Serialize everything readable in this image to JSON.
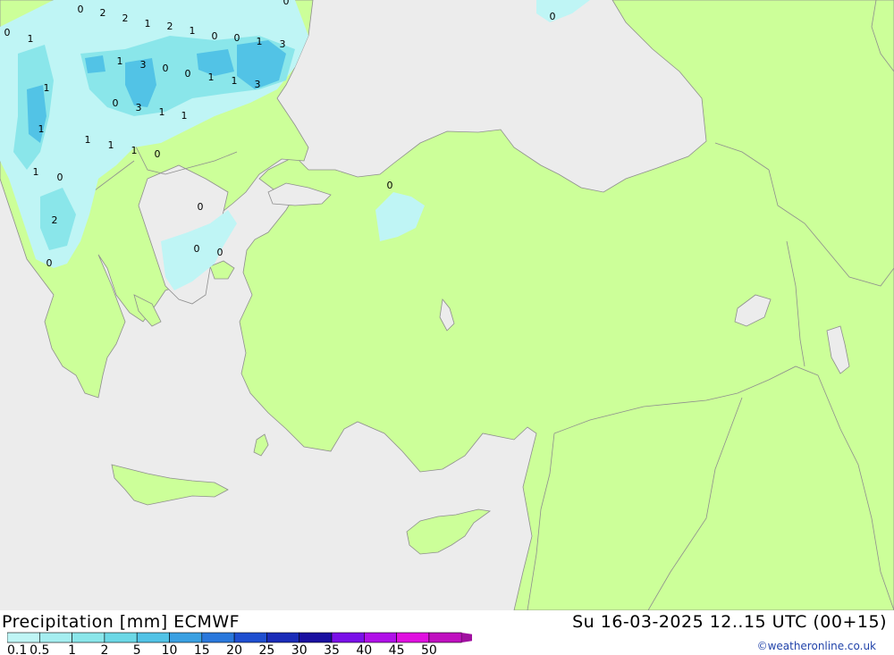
{
  "header": {
    "title": "Precipitation [mm] ECMWF",
    "datetime": "Su 16-03-2025 12..15 UTC (00+15)",
    "credit": "©weatheronline.co.uk"
  },
  "legend": {
    "ticks": [
      "0.1",
      "0.5",
      "1",
      "2",
      "5",
      "10",
      "15",
      "20",
      "25",
      "30",
      "35",
      "40",
      "45",
      "50"
    ],
    "colors": [
      "#bff5f5",
      "#a5eef0",
      "#8ae6ea",
      "#6cd8e6",
      "#52c3e6",
      "#3aa0e2",
      "#2a78dc",
      "#1f4fd0",
      "#1a2cb8",
      "#1a10a0",
      "#7a10e8",
      "#b010e8",
      "#e010e0",
      "#c010c0",
      "#a010a0"
    ]
  },
  "map": {
    "colors": {
      "land": "#ccff99",
      "sea": "#ececec",
      "border": "#8e8e8e",
      "precip_light": "#bff5f5",
      "precip_mid": "#8ae6ea",
      "precip_heavy": "#52c3e6"
    },
    "labels": [
      "0",
      "2",
      "2",
      "1",
      "2",
      "1",
      "0",
      "0",
      "1",
      "3",
      "0",
      "0",
      "1",
      "3",
      "0",
      "0",
      "1",
      "1",
      "3",
      "1",
      "0",
      "3",
      "1",
      "1",
      "1",
      "1",
      "1",
      "1",
      "1",
      "0",
      "2",
      "0",
      "0",
      "0",
      "0",
      "0",
      "0",
      "1",
      "0"
    ]
  }
}
